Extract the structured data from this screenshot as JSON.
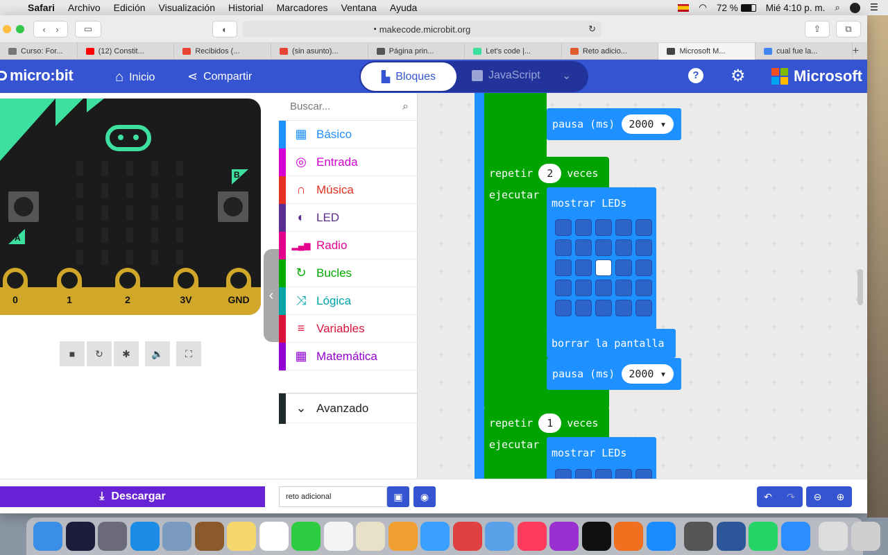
{
  "menubar": {
    "app": "Safari",
    "items": [
      "Archivo",
      "Edición",
      "Visualización",
      "Historial",
      "Marcadores",
      "Ventana",
      "Ayuda"
    ],
    "battery": "72 %",
    "clock": "Mié 4:10 p. m."
  },
  "browser": {
    "url": "makecode.microbit.org",
    "tabs": [
      "Curso: For...",
      "(12) Constit...",
      "Recibidos (...",
      "(sin asunto)...",
      "Página prin...",
      "Let's code |...",
      "Reto adicio...",
      "Microsoft M...",
      "cual fue la..."
    ],
    "active_tab_index": 7
  },
  "header": {
    "logo": "micro:bit",
    "home": "Inicio",
    "share": "Compartir",
    "blocks": "Bloques",
    "javascript": "JavaScript",
    "brand": "Microsoft"
  },
  "board": {
    "button_a": "A",
    "button_b": "B",
    "pins": [
      "0",
      "1",
      "2",
      "3V",
      "GND"
    ]
  },
  "toolbox": {
    "search_placeholder": "Buscar...",
    "categories": [
      {
        "label": "Básico",
        "color": "#1e90ff",
        "icon": "grid-icon"
      },
      {
        "label": "Entrada",
        "color": "#d400d4",
        "icon": "target-icon"
      },
      {
        "label": "Música",
        "color": "#e63022",
        "icon": "headphones-icon"
      },
      {
        "label": "LED",
        "color": "#5c2d91",
        "icon": "toggle-icon"
      },
      {
        "label": "Radio",
        "color": "#e3008c",
        "icon": "signal-icon"
      },
      {
        "label": "Bucles",
        "color": "#00aa00",
        "icon": "refresh-icon"
      },
      {
        "label": "Lógica",
        "color": "#00a4a6",
        "icon": "shuffle-icon"
      },
      {
        "label": "Variables",
        "color": "#dc143c",
        "icon": "lines-icon"
      },
      {
        "label": "Matemática",
        "color": "#9400d3",
        "icon": "calculator-icon"
      }
    ],
    "advanced": "Avanzado"
  },
  "workspace": {
    "pause_label": "pausa (ms)",
    "pause_value_1": "2000",
    "repeat_label": "repetir",
    "repeat_count_1": "2",
    "times_label": "veces",
    "do_label": "ejecutar",
    "show_leds_label": "mostrar LEDs",
    "clear_label": "borrar la pantalla",
    "pause_value_2": "2000",
    "repeat_count_2": "1",
    "led_matrix_on": [
      [
        2,
        2
      ]
    ]
  },
  "bottom": {
    "download": "Descargar",
    "project_name": "reto adicional"
  },
  "colors": {
    "header": "#3454d1",
    "loop_green": "#00a400",
    "basic_blue": "#1e90ff",
    "download": "#6722d6"
  }
}
